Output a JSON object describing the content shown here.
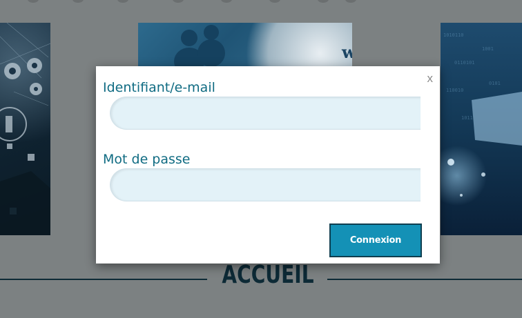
{
  "modal": {
    "close_label": "x",
    "login_label": "Identifiant/e-mail",
    "login_value": "",
    "password_label": "Mot de passe",
    "password_value": "",
    "submit_label": "Connexion"
  },
  "background": {
    "section_heading": "ACCUEIL"
  },
  "colors": {
    "overlay": "#7c8182",
    "label_text": "#0f6b82",
    "input_bg": "#e3f2f8",
    "button_bg": "#1491b6",
    "heading": "#0d2a36"
  }
}
